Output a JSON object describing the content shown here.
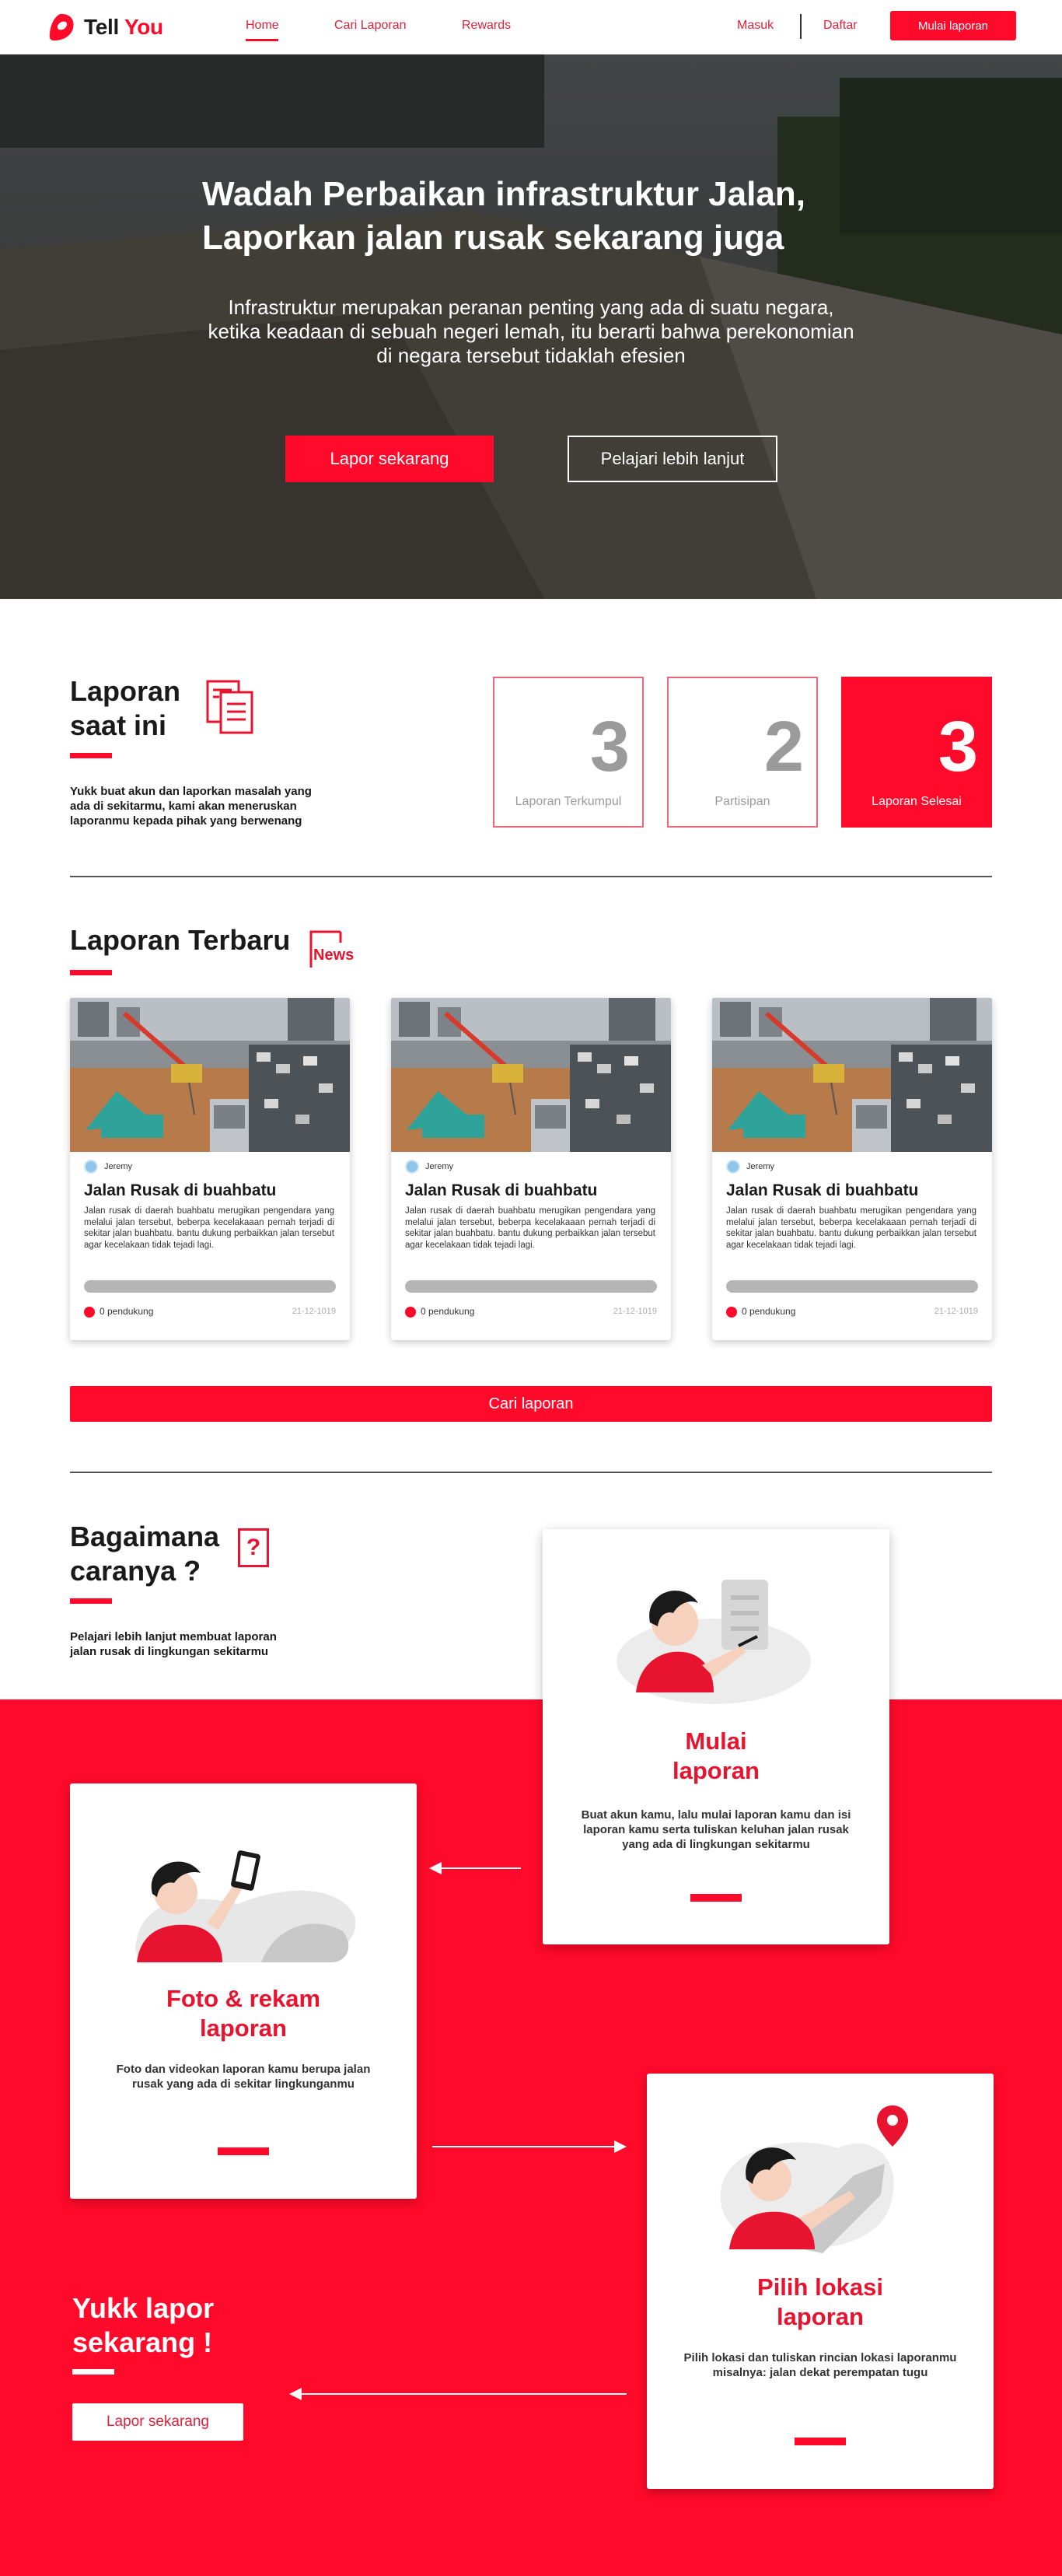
{
  "nav": {
    "logo_word1": "Tell",
    "logo_word2": "You",
    "links": [
      "Home",
      "Cari Laporan",
      "Rewards"
    ],
    "login": "Masuk",
    "register": "Daftar",
    "cta": "Mulai laporan"
  },
  "hero": {
    "title_line1": "Wadah Perbaikan infrastruktur Jalan,",
    "title_line2": "Laporkan jalan rusak sekarang juga",
    "subtitle_line1": "Infrastruktur merupakan peranan penting yang ada di suatu negara,",
    "subtitle_line2": "ketika keadaan di sebuah negeri lemah, itu berarti bahwa perekonomian",
    "subtitle_line3": "di negara tersebut tidaklah efesien",
    "primary_button": "Lapor sekarang",
    "secondary_button": "Pelajari lebih lanjut"
  },
  "stats": {
    "title_line1": "Laporan",
    "title_line2": "saat ini",
    "desc_line1": "Yukk buat akun dan laporkan masalah yang",
    "desc_line2": "ada di sekitarmu, kami akan meneruskan",
    "desc_line3": "laporanmu kepada pihak yang berwenang",
    "cards": [
      {
        "value": "3",
        "label": "Laporan Terkumpul"
      },
      {
        "value": "2",
        "label": "Partisipan"
      },
      {
        "value": "3",
        "label": "Laporan Selesai"
      }
    ]
  },
  "latest": {
    "title": "Laporan Terbaru",
    "badge": "News",
    "cards": [
      {
        "author": "Jeremy",
        "title": "Jalan Rusak di buahbatu",
        "body": "Jalan rusak di daerah buahbatu merugikan pengendara yang melalui jalan tersebut, beberpa kecelakaaan pernah terjadi di sekitar jalan buahbatu. bantu dukung perbaikkan jalan tersebut agar kecelakaan tidak tejadi lagi.",
        "progress": 0,
        "supporters": "0 pendukung",
        "date": "21-12-1019"
      },
      {
        "author": "Jeremy",
        "title": "Jalan Rusak di buahbatu",
        "body": "Jalan rusak di daerah buahbatu merugikan pengendara yang melalui jalan tersebut, beberpa kecelakaaan pernah terjadi di sekitar jalan buahbatu. bantu dukung perbaikkan jalan tersebut agar kecelakaan tidak tejadi lagi.",
        "progress": 0,
        "supporters": "0 pendukung",
        "date": "21-12-1019"
      },
      {
        "author": "Jeremy",
        "title": "Jalan Rusak di buahbatu",
        "body": "Jalan rusak di daerah buahbatu merugikan pengendara yang melalui jalan tersebut, beberpa kecelakaaan pernah terjadi di sekitar jalan buahbatu. bantu dukung perbaikkan jalan tersebut agar kecelakaan tidak tejadi lagi.",
        "progress": 0,
        "supporters": "0 pendukung",
        "date": "21-12-1019"
      }
    ],
    "search_button": "Cari laporan"
  },
  "howto": {
    "title_line1": "Bagaimana",
    "title_line2": "caranya ?",
    "badge": "?",
    "desc_line1": "Pelajari lebih lanjut membuat laporan",
    "desc_line2": "jalan rusak di lingkungan sekitarmu",
    "steps": [
      {
        "title_line1": "Mulai",
        "title_line2": "laporan",
        "desc": "Buat akun kamu, lalu mulai laporan kamu dan isi laporan kamu serta tuliskan keluhan jalan rusak yang ada di lingkungan sekitarmu"
      },
      {
        "title_line1": "Foto & rekam",
        "title_line2": "laporan",
        "desc": "Foto dan videokan laporan kamu berupa jalan rusak yang ada di sekitar lingkunganmu"
      },
      {
        "title_line1": "Pilih lokasi",
        "title_line2": "laporan",
        "desc": "Pilih lokasi dan tuliskan rincian lokasi laporanmu misalnya: jalan dekat perempatan tugu"
      }
    ],
    "cta_line1": "Yukk lapor",
    "cta_line2": "sekarang !",
    "cta_button": "Lapor sekarang"
  },
  "colors": {
    "accent": "#ff0a2a",
    "muted": "#9b9b9b"
  }
}
